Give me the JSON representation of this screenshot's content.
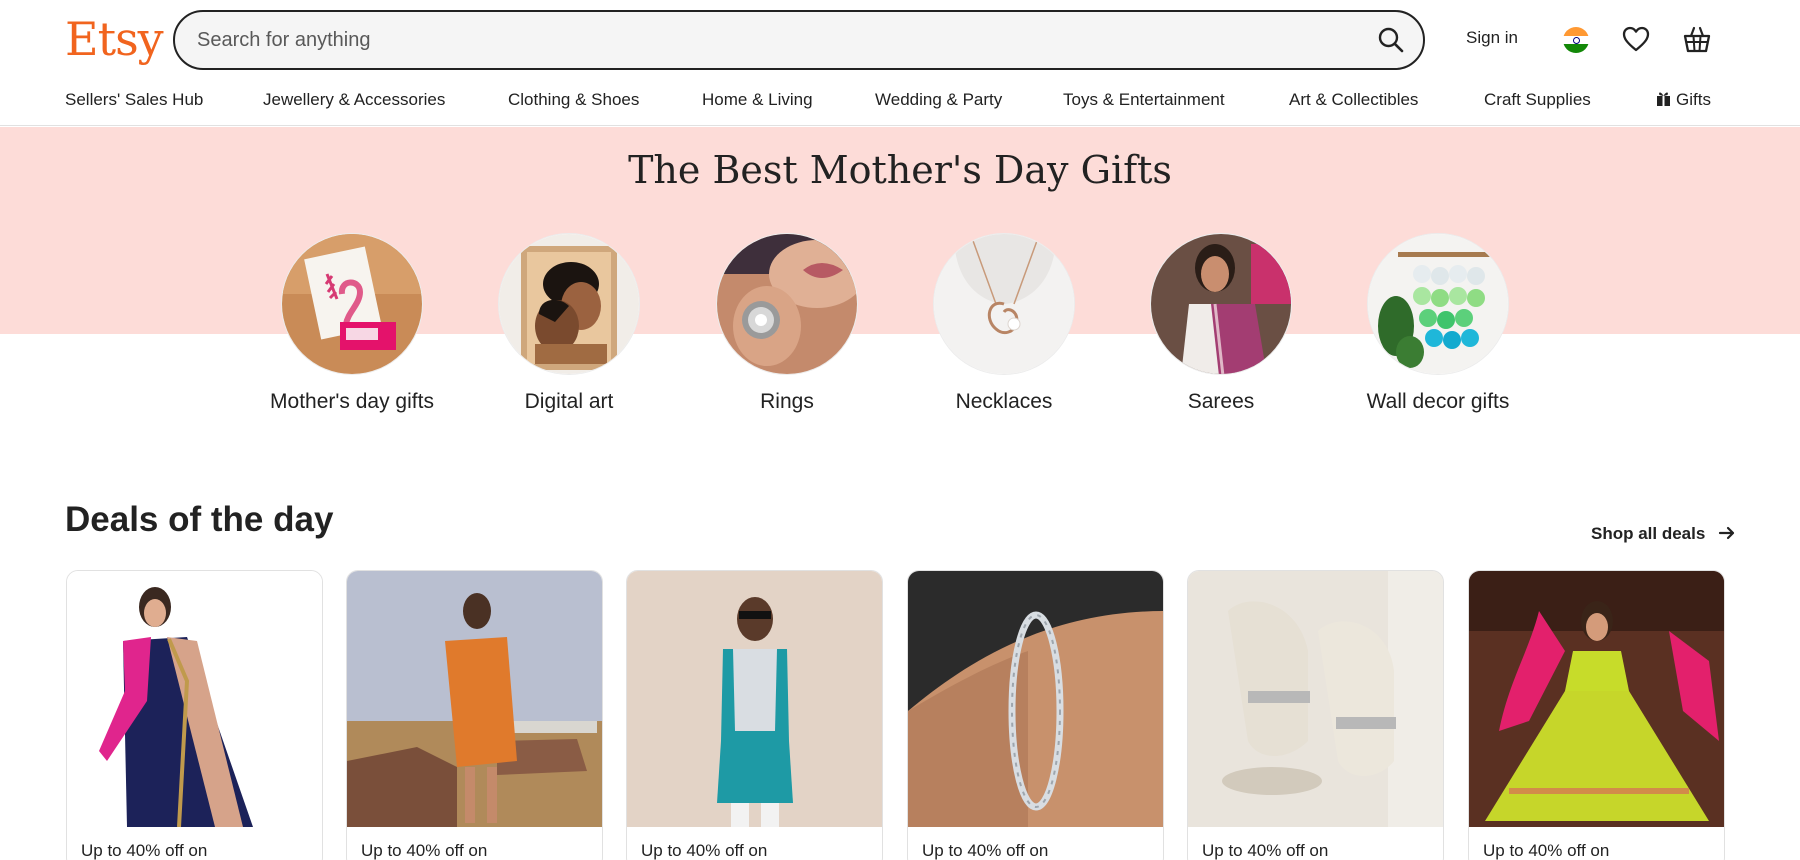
{
  "header": {
    "logo": "Etsy",
    "search_placeholder": "Search for anything",
    "sign_in": "Sign in",
    "icons": [
      "search-icon",
      "india-flag-icon",
      "heart-icon",
      "basket-icon"
    ]
  },
  "nav": {
    "items": [
      "Sellers' Sales Hub",
      "Jewellery & Accessories",
      "Clothing & Shoes",
      "Home & Living",
      "Wedding & Party",
      "Toys & Entertainment",
      "Art & Collectibles",
      "Craft Supplies",
      "Gifts"
    ]
  },
  "hero": {
    "title": "The Best Mother's Day Gifts",
    "background_color": "#FDDCD8",
    "categories": [
      {
        "label": "Mother's day gifts"
      },
      {
        "label": "Digital art"
      },
      {
        "label": "Rings"
      },
      {
        "label": "Necklaces"
      },
      {
        "label": "Sarees"
      },
      {
        "label": "Wall decor gifts"
      }
    ]
  },
  "deals": {
    "title": "Deals of the day",
    "shop_all": "Shop all deals",
    "items": [
      {
        "label": "Up to 40% off on"
      },
      {
        "label": "Up to 40% off on"
      },
      {
        "label": "Up to 40% off on"
      },
      {
        "label": "Up to 40% off on"
      },
      {
        "label": "Up to 40% off on"
      },
      {
        "label": "Up to 40% off on"
      }
    ]
  },
  "colors": {
    "brand": "#F1641E",
    "text": "#222222"
  }
}
